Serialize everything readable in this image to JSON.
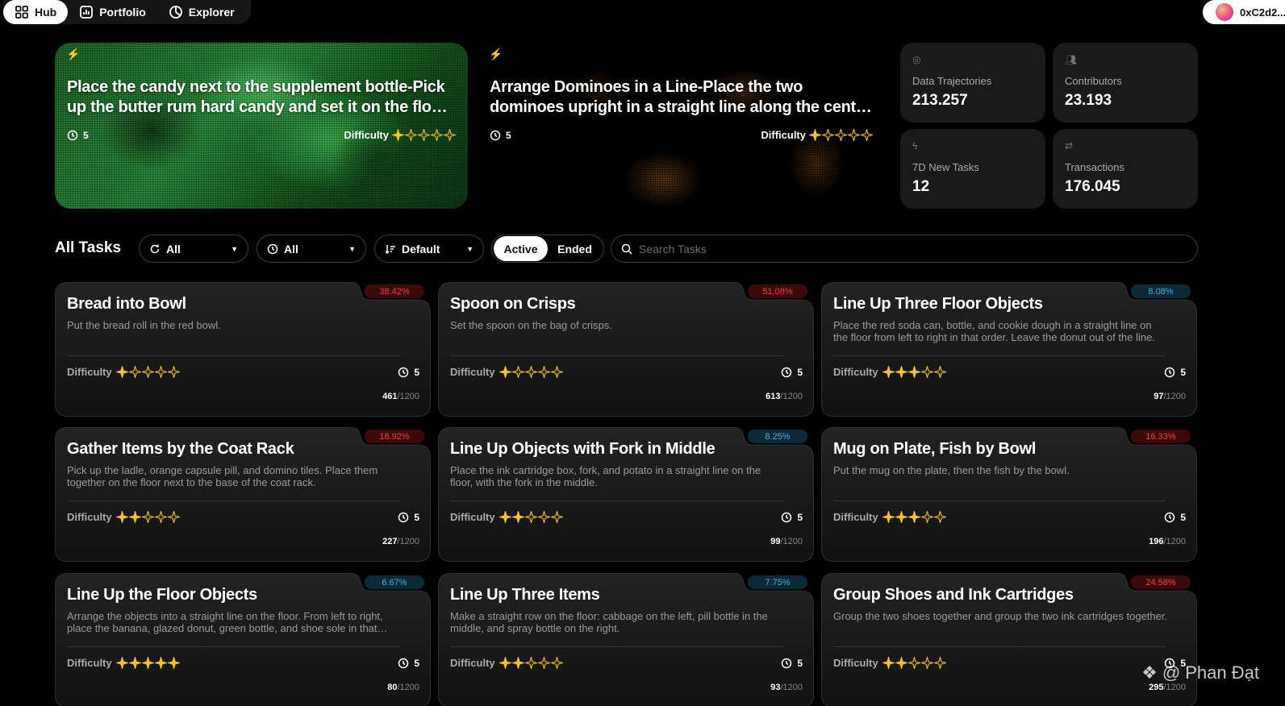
{
  "nav": {
    "items": [
      {
        "label": "Hub",
        "icon": "grid-icon"
      },
      {
        "label": "Portfolio",
        "icon": "chart-icon"
      },
      {
        "label": "Explorer",
        "icon": "compass-icon"
      }
    ],
    "wallet": "0xC2d2..."
  },
  "hero": [
    {
      "title": "Place the candy next to the supplement bottle-Pick up the butter rum hard candy and set it on the floor next to the supplement bottle.",
      "timer": "5",
      "difficulty_label": "Difficulty",
      "stars": 1,
      "accent": "#39d455"
    },
    {
      "title": "Arrange Dominoes in a Line-Place the two dominoes upright in a straight line along the center of the table.",
      "timer": "5",
      "difficulty_label": "Difficulty",
      "stars": 1,
      "accent": "#e8a52c"
    }
  ],
  "stats": [
    {
      "label": "Data Trajectories",
      "value": "213.257",
      "icon": "target-icon"
    },
    {
      "label": "Contributors",
      "value": "23.193",
      "icon": "users-icon"
    },
    {
      "label": "7D New Tasks",
      "value": "12",
      "icon": "bolt-icon"
    },
    {
      "label": "Transactions",
      "value": "176.045",
      "icon": "arrows-icon"
    }
  ],
  "filters": {
    "title": "All Tasks",
    "category": "All",
    "time": "All",
    "sort": "Default",
    "active_label": "Active",
    "ended_label": "Ended",
    "search_placeholder": "Search Tasks"
  },
  "tasks": [
    {
      "title": "Bread into Bowl",
      "desc": "Put the bread roll in the red bowl.",
      "badge": "38.42%",
      "badge_color": "red",
      "stars": 1,
      "timer": "5",
      "done": "461",
      "total": "/1200"
    },
    {
      "title": "Spoon on Crisps",
      "desc": "Set the spoon on the bag of crisps.",
      "badge": "51.08%",
      "badge_color": "red",
      "stars": 1,
      "timer": "5",
      "done": "613",
      "total": "/1200"
    },
    {
      "title": "Line Up Three Floor Objects",
      "desc": "Place the red soda can, bottle, and cookie dough in a straight line on the floor from left to right in that order. Leave the donut out of the line.",
      "badge": "8.08%",
      "badge_color": "blue",
      "stars": 3,
      "timer": "5",
      "done": "97",
      "total": "/1200"
    },
    {
      "title": "Gather Items by the Coat Rack",
      "desc": "Pick up the ladle, orange capsule pill, and domino tiles. Place them together on the floor next to the base of the coat rack.",
      "badge": "18.92%",
      "badge_color": "red",
      "stars": 2,
      "timer": "5",
      "done": "227",
      "total": "/1200"
    },
    {
      "title": "Line Up Objects with Fork in Middle",
      "desc": "Place the ink cartridge box, fork, and potato in a straight line on the floor, with the fork in the middle.",
      "badge": "8.25%",
      "badge_color": "blue",
      "stars": 2,
      "timer": "5",
      "done": "99",
      "total": "/1200"
    },
    {
      "title": "Mug on Plate, Fish by Bowl",
      "desc": "Put the mug on the plate, then the fish by the bowl.",
      "badge": "16.33%",
      "badge_color": "red",
      "stars": 3,
      "timer": "5",
      "done": "196",
      "total": "/1200"
    },
    {
      "title": "Line Up the Floor Objects",
      "desc": "Arrange the objects into a straight line on the floor. From left to right, place the banana, glazed donut, green bottle, and shoe sole in that order.",
      "badge": "6.67%",
      "badge_color": "blue",
      "stars": 5,
      "timer": "5",
      "done": "80",
      "total": "/1200"
    },
    {
      "title": "Line Up Three Items",
      "desc": "Make a straight row on the floor: cabbage on the left, pill bottle in the middle, and spray bottle on the right.",
      "badge": "7.75%",
      "badge_color": "blue",
      "stars": 2,
      "timer": "5",
      "done": "93",
      "total": "/1200"
    },
    {
      "title": "Group Shoes and Ink Cartridges",
      "desc": "Group the two shoes together and group the two ink cartridges together.",
      "badge": "24.58%",
      "badge_color": "red",
      "stars": 2,
      "timer": "5",
      "done": "295",
      "total": "/1200"
    }
  ],
  "difficulty_label": "Difficulty",
  "watermark": "@ Phan Đạt",
  "colors": {
    "star": "#f5c518",
    "badge_red": "#ff3b3b",
    "badge_blue": "#2ab6e8"
  }
}
